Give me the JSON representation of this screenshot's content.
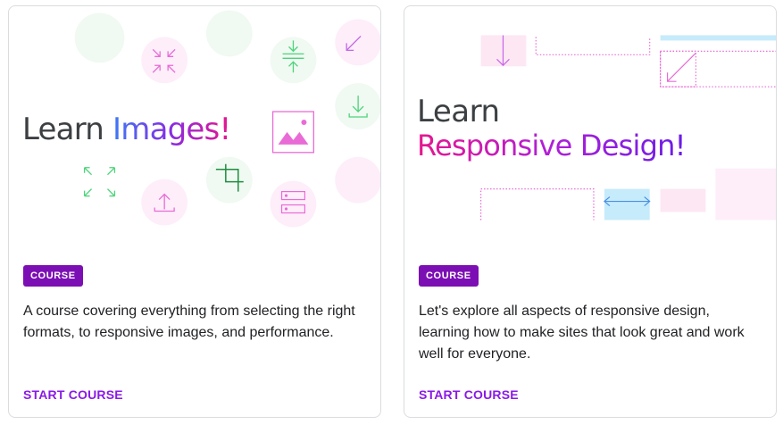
{
  "cards": [
    {
      "title_prefix": "Learn",
      "title_highlight": "Images!",
      "badge": "COURSE",
      "description": "A course covering everything from selecting the right formats, to responsive images, and performance.",
      "cta": "START COURSE"
    },
    {
      "title_line1": "Learn",
      "title_line2": "Responsive Design!",
      "badge": "COURSE",
      "description": "Let's explore all aspects of responsive design, learning how to make sites that look great and work well for everyone.",
      "cta": "START COURSE"
    }
  ],
  "colors": {
    "badge_bg": "#7c0fb4",
    "cta": "#8a1ae6",
    "pink": "#e6178e",
    "purple": "#8a2be2",
    "blue": "#3d7af5",
    "green": "#34d058"
  },
  "icons": [
    "collapse-icon",
    "compress-icon",
    "arrow-in-icon",
    "image-icon",
    "download-icon",
    "expand-icon",
    "crop-icon",
    "upload-icon",
    "storage-icon",
    "arrow-down-icon",
    "arrow-left-right-icon"
  ]
}
